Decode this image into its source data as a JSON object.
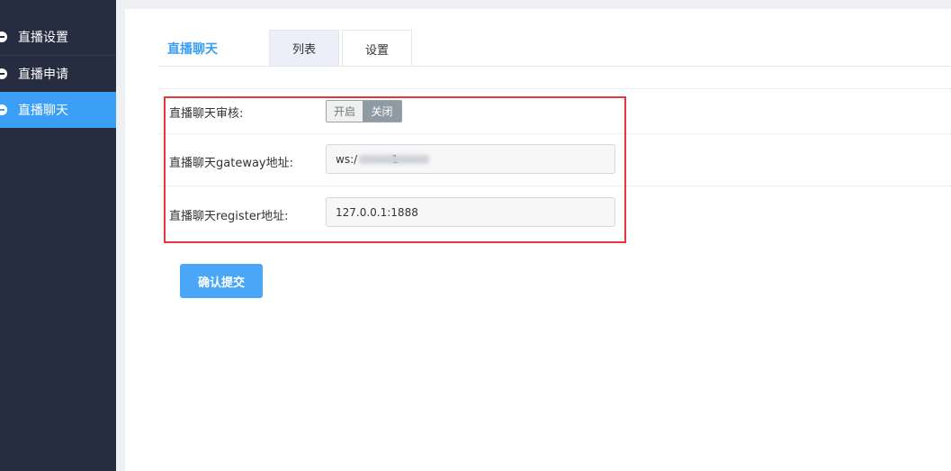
{
  "sidebar": {
    "items": [
      {
        "label": "直播设置",
        "icon": "circle-minus-icon"
      },
      {
        "label": "直播申请",
        "icon": "circle-minus-icon"
      },
      {
        "label": "直播聊天",
        "icon": "circle-minus-icon",
        "active": true
      }
    ]
  },
  "header": {
    "title": "直播聊天",
    "tabs": [
      {
        "label": "列表"
      },
      {
        "label": "设置",
        "active": true
      }
    ]
  },
  "form": {
    "review": {
      "label": "直播聊天审核:",
      "on_label": "开启",
      "off_label": "关闭",
      "value": "关闭"
    },
    "gateway": {
      "label": "直播聊天gateway地址:",
      "value": "ws:/          1"
    },
    "register": {
      "label": "直播聊天register地址:",
      "value": "127.0.0.1:1888"
    },
    "submit_label": "确认提交"
  },
  "colors": {
    "accent": "#3a9ff5",
    "sidebar_bg": "#262d40",
    "highlight_border": "#e8373a"
  }
}
